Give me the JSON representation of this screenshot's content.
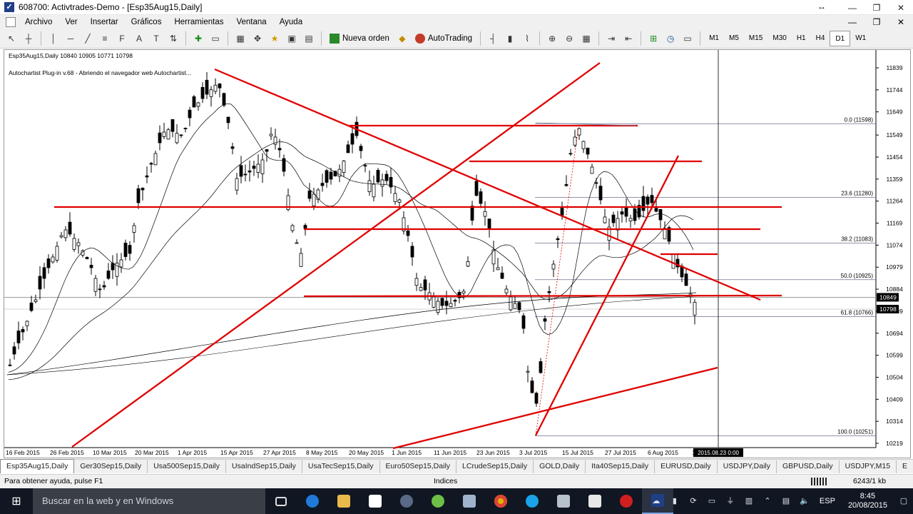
{
  "window": {
    "title": "608700: Activtrades-Demo - [Esp35Aug15,Daily]",
    "icon": "metatrader-icon",
    "resize_arrows": "↔",
    "controls": [
      "—",
      "❐",
      "✕"
    ]
  },
  "menu": {
    "items": [
      "Archivo",
      "Ver",
      "Insertar",
      "Gráficos",
      "Herramientas",
      "Ventana",
      "Ayuda"
    ],
    "mdi_controls": [
      "—",
      "❐",
      "✕"
    ]
  },
  "toolbar": {
    "new_order_label": "Nueva orden",
    "autotrading_label": "AutoTrading",
    "timeframes": [
      "M1",
      "M5",
      "M15",
      "M30",
      "H1",
      "H4",
      "D1",
      "W1"
    ],
    "active_timeframe": "D1"
  },
  "chart": {
    "header": "Esp35Aug15,Daily  10840 10905 10771 10798",
    "note": "Autochartist Plug-in v.68 - Abriendo el navegador web Autochartist...",
    "price_labels": [
      "11839",
      "11744",
      "11649",
      "11549",
      "11454",
      "11359",
      "11264",
      "11169",
      "11074",
      "10979",
      "10884",
      "10789",
      "10694",
      "10599",
      "10504",
      "10409",
      "10314",
      "10219"
    ],
    "current_price_labels": [
      "10849",
      "10798"
    ],
    "fib_labels": [
      "0.0 (11598)",
      "23.6 (11280)",
      "38.2 (11083)",
      "50.0 (10925)",
      "61.8 (10766)",
      "100.0 (10251)"
    ],
    "date_labels": [
      "16 Feb 2015",
      "26 Feb 2015",
      "10 Mar 2015",
      "20 Mar 2015",
      "1 Apr 2015",
      "15 Apr 2015",
      "27 Apr 2015",
      "8 May 2015",
      "20 May 2015",
      "1 Jun 2015",
      "11 Jun 2015",
      "23 Jun 2015",
      "3 Jul 2015",
      "15 Jul 2015",
      "27 Jul 2015",
      "6 Aug 2015",
      "1"
    ],
    "cursor_date": "2015.08.23 0:00"
  },
  "chart_data": {
    "type": "candlestick",
    "symbol": "Esp35Aug15",
    "timeframe": "Daily",
    "ohlc_last": {
      "open": 10840,
      "high": 10905,
      "low": 10771,
      "close": 10798
    },
    "ylim": [
      10219,
      11839
    ],
    "fibonacci": [
      {
        "level": "0.0",
        "price": 11598
      },
      {
        "level": "23.6",
        "price": 11280
      },
      {
        "level": "38.2",
        "price": 11083
      },
      {
        "level": "50.0",
        "price": 10925
      },
      {
        "level": "61.8",
        "price": 10766
      },
      {
        "level": "100.0",
        "price": 10251
      }
    ],
    "bid": 10849,
    "last": 10798
  },
  "tabs": {
    "items": [
      "Esp35Aug15,Daily",
      "Ger30Sep15,Daily",
      "Usa500Sep15,Daily",
      "UsaIndSep15,Daily",
      "UsaTecSep15,Daily",
      "Euro50Sep15,Daily",
      "LCrudeSep15,Daily",
      "GOLD,Daily",
      "Ita40Sep15,Daily",
      "EURUSD,Daily",
      "USDJPY,Daily",
      "GBPUSD,Daily",
      "USDJPY,M15",
      "E"
    ],
    "active": 0
  },
  "status": {
    "help": "Para obtener ayuda, pulse F1",
    "profile": "Indices",
    "traffic": "6243/1 kb"
  },
  "taskbar": {
    "search_placeholder": "Buscar en la web y en Windows",
    "language": "ESP",
    "time": "8:45",
    "date": "20/08/2015"
  },
  "colors": {
    "trendline": "#e00000",
    "candle_bull": "#ffffff",
    "candle_bear": "#000000",
    "fib_line": "#6f6f8f",
    "taskbar": "#101622"
  }
}
